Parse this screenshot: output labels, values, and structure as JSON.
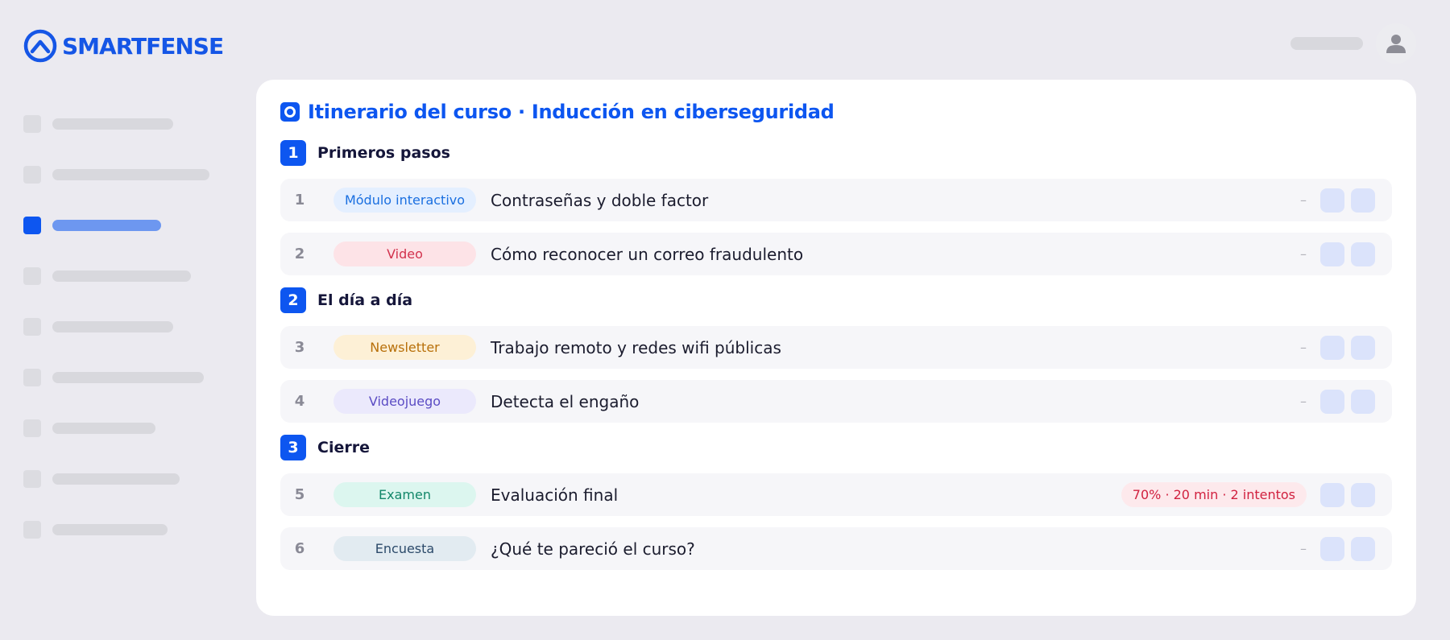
{
  "brand": {
    "name": "SMARTFENSE",
    "color": "#1556e6"
  },
  "header": {
    "avatar_icon": "user-icon"
  },
  "sidebar": {
    "active_index": 2,
    "item_count": 9
  },
  "course": {
    "title": "Itinerario del curso · Inducción en ciberseguridad",
    "title_icon": "record-icon",
    "sections": [
      {
        "number": "1",
        "title": "Primeros pasos"
      },
      {
        "number": "2",
        "title": "El día a día"
      },
      {
        "number": "3",
        "title": "Cierre"
      }
    ],
    "items": [
      {
        "number": "1",
        "type": "Módulo interactivo",
        "title": "Contraseñas y doble factor",
        "meta": "–"
      },
      {
        "number": "2",
        "type": "Video",
        "title": "Cómo reconocer un correo fraudulento",
        "meta": "–"
      },
      {
        "number": "3",
        "type": "Newsletter",
        "title": "Trabajo remoto y redes wifi públicas",
        "meta": "–"
      },
      {
        "number": "4",
        "type": "Videojuego",
        "title": "Detecta el engaño",
        "meta": "–"
      },
      {
        "number": "5",
        "type": "Examen",
        "title": "Evaluación final",
        "meta": "70% · 20 min · 2 intentos"
      },
      {
        "number": "6",
        "type": "Encuesta",
        "title": "¿Qué te pareció el curso?",
        "meta": "–"
      }
    ]
  },
  "colors": {
    "accent": "#0d56f0",
    "badge_modulo_bg": "#e4efff",
    "badge_modulo_fg": "#1a6fe0",
    "badge_video_bg": "#fde3e7",
    "badge_video_fg": "#d2324d",
    "badge_newsletter_bg": "#fdf0d6",
    "badge_newsletter_fg": "#b8700a",
    "badge_videojuego_bg": "#ebe9fc",
    "badge_videojuego_fg": "#5b4cc4",
    "badge_examen_bg": "#dcf6ef",
    "badge_examen_fg": "#13876a",
    "badge_encuesta_bg": "#e2ebf1",
    "badge_encuesta_fg": "#2c4a6a",
    "alert_bg": "#fde9ec",
    "alert_fg": "#d1213f"
  }
}
